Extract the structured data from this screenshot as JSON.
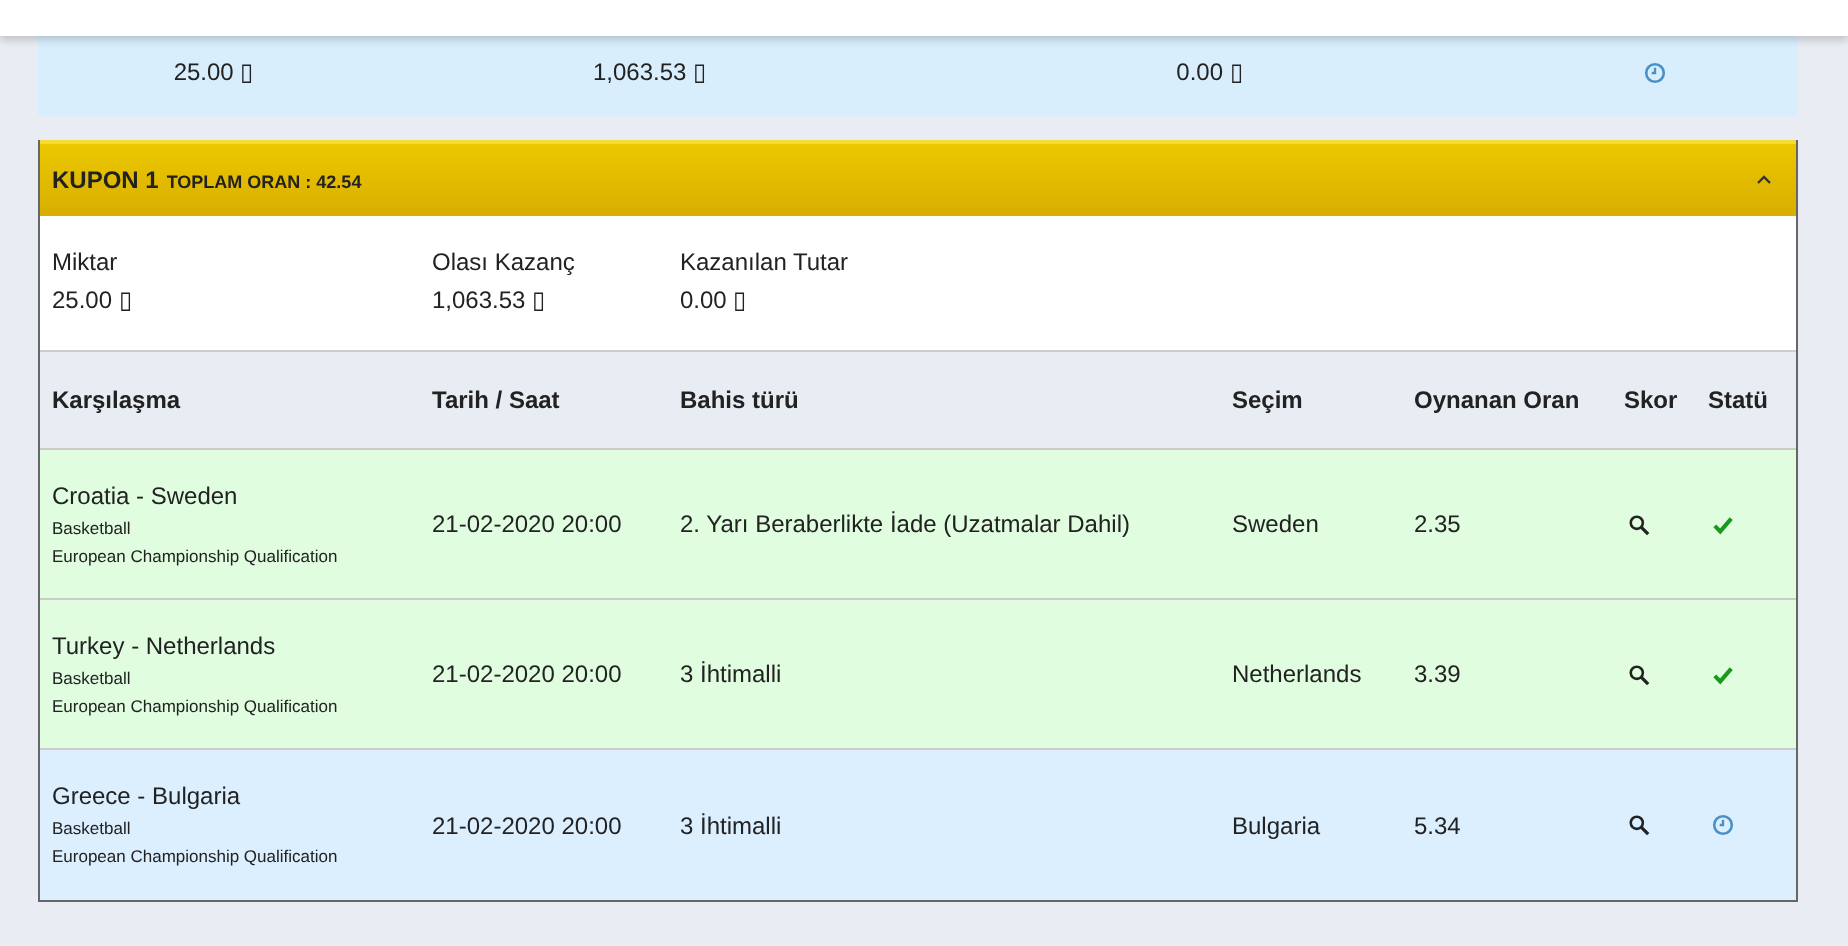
{
  "previous_coupon_summary": {
    "fields": [
      {
        "value": "25.00 ▯"
      },
      {
        "value": "1,063.53 ▯"
      },
      {
        "value": "0.00 ▯"
      }
    ],
    "kind": "pending"
  },
  "coupon": {
    "title": "KUPON 1",
    "total_odds": "TOPLAM ORAN : 42.54",
    "expanded": true,
    "summary": [
      {
        "label": "Miktar",
        "value": "25.00 ▯"
      },
      {
        "label": "Olası Kazanç",
        "value": "1,063.53 ▯"
      },
      {
        "label": "Kazanılan Tutar",
        "value": "0.00 ▯"
      }
    ],
    "table": {
      "columns": [
        "Karşılaşma",
        "Tarih / Saat",
        "Bahis türü",
        "Seçim",
        "Oynanan Oran",
        "Skor",
        "Statü"
      ],
      "rows": [
        {
          "match": "Croatia - Sweden",
          "sport": "Basketball",
          "league": "European Championship Qualification",
          "datetime": "21-02-2020 20:00",
          "bet_type": "2. Yarı Beraberlikte İade (Uzatmalar Dahil)",
          "selection": "Sweden",
          "odds": "2.35",
          "kind": "won"
        },
        {
          "match": "Turkey - Netherlands",
          "sport": "Basketball",
          "league": "European Championship Qualification",
          "datetime": "21-02-2020 20:00",
          "bet_type": "3 İhtimalli",
          "selection": "Netherlands",
          "odds": "3.39",
          "kind": "won"
        },
        {
          "match": "Greece - Bulgaria",
          "sport": "Basketball",
          "league": "European Championship Qualification",
          "datetime": "21-02-2020 20:00",
          "bet_type": "3 İhtimalli",
          "selection": "Bulgaria",
          "odds": "5.34",
          "kind": "pending"
        }
      ]
    }
  }
}
